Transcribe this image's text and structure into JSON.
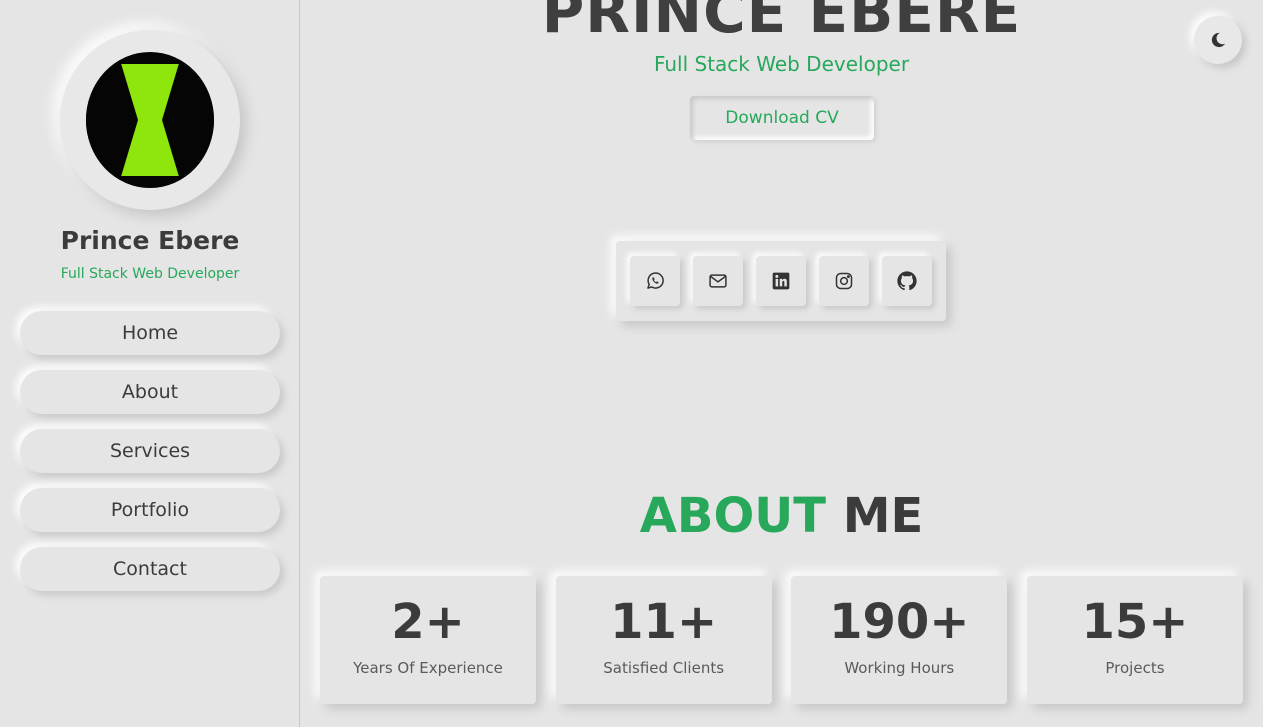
{
  "sidebar": {
    "avatar_icon": "omnitrix-logo",
    "name": "Prince Ebere",
    "role": "Full Stack Web Developer",
    "nav": [
      {
        "label": "Home"
      },
      {
        "label": "About"
      },
      {
        "label": "Services"
      },
      {
        "label": "Portfolio"
      },
      {
        "label": "Contact"
      }
    ]
  },
  "hero": {
    "name": "PRINCE EBERE",
    "role": "Full Stack Web Developer",
    "cv_label": "Download CV",
    "socials": [
      {
        "icon": "whatsapp-icon"
      },
      {
        "icon": "mail-icon"
      },
      {
        "icon": "linkedin-icon"
      },
      {
        "icon": "instagram-icon"
      },
      {
        "icon": "github-icon"
      }
    ]
  },
  "about": {
    "title_accent": "ABOUT",
    "title_rest": "ME",
    "stats": [
      {
        "value": "2+",
        "label": "Years Of Experience"
      },
      {
        "value": "11+",
        "label": "Satisfied Clients"
      },
      {
        "value": "190+",
        "label": "Working Hours"
      },
      {
        "value": "15+",
        "label": "Projects"
      }
    ]
  },
  "theme_toggle": {
    "icon": "moon-icon"
  },
  "colors": {
    "accent": "#27a85a",
    "background": "#e5e5e5",
    "text": "#3b3b3b",
    "logo_green": "#8ee60c"
  }
}
